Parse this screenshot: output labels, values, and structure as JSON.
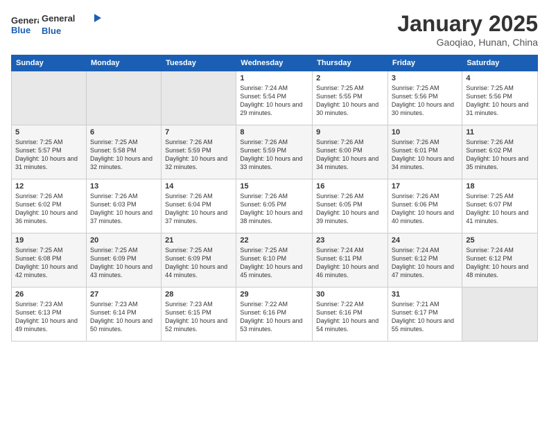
{
  "header": {
    "logo_line1": "General",
    "logo_line2": "Blue",
    "title": "January 2025",
    "subtitle": "Gaoqiao, Hunan, China"
  },
  "days_of_week": [
    "Sunday",
    "Monday",
    "Tuesday",
    "Wednesday",
    "Thursday",
    "Friday",
    "Saturday"
  ],
  "weeks": [
    {
      "cells": [
        {
          "empty": true
        },
        {
          "empty": true
        },
        {
          "empty": true
        },
        {
          "day": "1",
          "sunrise": "7:24 AM",
          "sunset": "5:54 PM",
          "daylight": "10 hours and 29 minutes."
        },
        {
          "day": "2",
          "sunrise": "7:25 AM",
          "sunset": "5:55 PM",
          "daylight": "10 hours and 30 minutes."
        },
        {
          "day": "3",
          "sunrise": "7:25 AM",
          "sunset": "5:56 PM",
          "daylight": "10 hours and 30 minutes."
        },
        {
          "day": "4",
          "sunrise": "7:25 AM",
          "sunset": "5:56 PM",
          "daylight": "10 hours and 31 minutes."
        }
      ]
    },
    {
      "cells": [
        {
          "day": "5",
          "sunrise": "7:25 AM",
          "sunset": "5:57 PM",
          "daylight": "10 hours and 31 minutes."
        },
        {
          "day": "6",
          "sunrise": "7:25 AM",
          "sunset": "5:58 PM",
          "daylight": "10 hours and 32 minutes."
        },
        {
          "day": "7",
          "sunrise": "7:26 AM",
          "sunset": "5:59 PM",
          "daylight": "10 hours and 32 minutes."
        },
        {
          "day": "8",
          "sunrise": "7:26 AM",
          "sunset": "5:59 PM",
          "daylight": "10 hours and 33 minutes."
        },
        {
          "day": "9",
          "sunrise": "7:26 AM",
          "sunset": "6:00 PM",
          "daylight": "10 hours and 34 minutes."
        },
        {
          "day": "10",
          "sunrise": "7:26 AM",
          "sunset": "6:01 PM",
          "daylight": "10 hours and 34 minutes."
        },
        {
          "day": "11",
          "sunrise": "7:26 AM",
          "sunset": "6:02 PM",
          "daylight": "10 hours and 35 minutes."
        }
      ]
    },
    {
      "cells": [
        {
          "day": "12",
          "sunrise": "7:26 AM",
          "sunset": "6:02 PM",
          "daylight": "10 hours and 36 minutes."
        },
        {
          "day": "13",
          "sunrise": "7:26 AM",
          "sunset": "6:03 PM",
          "daylight": "10 hours and 37 minutes."
        },
        {
          "day": "14",
          "sunrise": "7:26 AM",
          "sunset": "6:04 PM",
          "daylight": "10 hours and 37 minutes."
        },
        {
          "day": "15",
          "sunrise": "7:26 AM",
          "sunset": "6:05 PM",
          "daylight": "10 hours and 38 minutes."
        },
        {
          "day": "16",
          "sunrise": "7:26 AM",
          "sunset": "6:05 PM",
          "daylight": "10 hours and 39 minutes."
        },
        {
          "day": "17",
          "sunrise": "7:26 AM",
          "sunset": "6:06 PM",
          "daylight": "10 hours and 40 minutes."
        },
        {
          "day": "18",
          "sunrise": "7:25 AM",
          "sunset": "6:07 PM",
          "daylight": "10 hours and 41 minutes."
        }
      ]
    },
    {
      "cells": [
        {
          "day": "19",
          "sunrise": "7:25 AM",
          "sunset": "6:08 PM",
          "daylight": "10 hours and 42 minutes."
        },
        {
          "day": "20",
          "sunrise": "7:25 AM",
          "sunset": "6:09 PM",
          "daylight": "10 hours and 43 minutes."
        },
        {
          "day": "21",
          "sunrise": "7:25 AM",
          "sunset": "6:09 PM",
          "daylight": "10 hours and 44 minutes."
        },
        {
          "day": "22",
          "sunrise": "7:25 AM",
          "sunset": "6:10 PM",
          "daylight": "10 hours and 45 minutes."
        },
        {
          "day": "23",
          "sunrise": "7:24 AM",
          "sunset": "6:11 PM",
          "daylight": "10 hours and 46 minutes."
        },
        {
          "day": "24",
          "sunrise": "7:24 AM",
          "sunset": "6:12 PM",
          "daylight": "10 hours and 47 minutes."
        },
        {
          "day": "25",
          "sunrise": "7:24 AM",
          "sunset": "6:12 PM",
          "daylight": "10 hours and 48 minutes."
        }
      ]
    },
    {
      "cells": [
        {
          "day": "26",
          "sunrise": "7:23 AM",
          "sunset": "6:13 PM",
          "daylight": "10 hours and 49 minutes."
        },
        {
          "day": "27",
          "sunrise": "7:23 AM",
          "sunset": "6:14 PM",
          "daylight": "10 hours and 50 minutes."
        },
        {
          "day": "28",
          "sunrise": "7:23 AM",
          "sunset": "6:15 PM",
          "daylight": "10 hours and 52 minutes."
        },
        {
          "day": "29",
          "sunrise": "7:22 AM",
          "sunset": "6:16 PM",
          "daylight": "10 hours and 53 minutes."
        },
        {
          "day": "30",
          "sunrise": "7:22 AM",
          "sunset": "6:16 PM",
          "daylight": "10 hours and 54 minutes."
        },
        {
          "day": "31",
          "sunrise": "7:21 AM",
          "sunset": "6:17 PM",
          "daylight": "10 hours and 55 minutes."
        },
        {
          "empty": true
        }
      ]
    }
  ],
  "labels": {
    "sunrise": "Sunrise:",
    "sunset": "Sunset:",
    "daylight": "Daylight:"
  }
}
